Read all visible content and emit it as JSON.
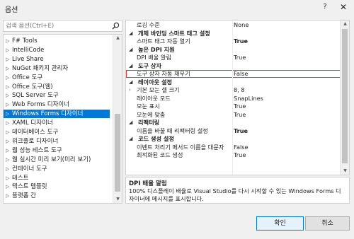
{
  "window": {
    "title": "옵션",
    "help_label": "?",
    "close_label": "✕"
  },
  "search": {
    "placeholder": "검색 옵션(Ctrl+E)"
  },
  "tree": {
    "items": [
      {
        "label": "F# Tools"
      },
      {
        "label": "IntelliCode"
      },
      {
        "label": "Live Share"
      },
      {
        "label": "NuGet 패키지 관리자"
      },
      {
        "label": "Office 도구"
      },
      {
        "label": "Office 도구(웹)"
      },
      {
        "label": "SQL Server 도구"
      },
      {
        "label": "Web Forms 디자이너"
      },
      {
        "label": "Windows Forms 디자이너",
        "selected": true
      },
      {
        "label": "XAML 디자이너"
      },
      {
        "label": "데이터베이스 도구"
      },
      {
        "label": "워크플로 디자이너"
      },
      {
        "label": "웹 성능 테스트 도구"
      },
      {
        "label": "웹 실시간 미리 보기(미리 보기)"
      },
      {
        "label": "컨테이너 도구"
      },
      {
        "label": "테스트"
      },
      {
        "label": "텍스트 템플릿"
      },
      {
        "label": "플랫폼 간"
      }
    ]
  },
  "grid": {
    "rows": [
      {
        "type": "prop",
        "name": "로깅 수준",
        "value": "None"
      },
      {
        "type": "category",
        "name": "개체 바인딩 스마트 태그 설정"
      },
      {
        "type": "prop",
        "name": "스마트 태그 자동 열기",
        "value": "True",
        "bold": true
      },
      {
        "type": "category",
        "name": "높은 DPI 지원"
      },
      {
        "type": "prop",
        "name": "DPI 배율 알림",
        "value": "True"
      },
      {
        "type": "category",
        "name": "도구 상자"
      },
      {
        "type": "prop",
        "name": "도구 상자 자동 채우기",
        "value": "False",
        "highlight": true
      },
      {
        "type": "category",
        "name": "레이아웃 설정"
      },
      {
        "type": "prop",
        "name": "기본 모눈 셀 크기",
        "value": "8, 8",
        "expandable": true
      },
      {
        "type": "prop",
        "name": "레이아웃 모드",
        "value": "SnapLines"
      },
      {
        "type": "prop",
        "name": "모눈 표시",
        "value": "True"
      },
      {
        "type": "prop",
        "name": "모눈에 맞춤",
        "value": "True"
      },
      {
        "type": "category",
        "name": "리팩터링"
      },
      {
        "type": "prop",
        "name": "이름을 바꿀 때 리팩터링 설정",
        "value": "True",
        "bold": true
      },
      {
        "type": "category",
        "name": "코드 생성 설정"
      },
      {
        "type": "prop",
        "name": "이벤트 처리기 메서드 이름을 대문자",
        "value": "False"
      },
      {
        "type": "prop",
        "name": "최적화된 코드 생성",
        "value": "True"
      }
    ]
  },
  "description": {
    "title": "DPI 배율 알림",
    "text": "100% 디스플레이 배율로 Visual Studio를 다시 시작할 수 있는 Windows Forms 디자이너에 메시지를 표시합니다."
  },
  "buttons": {
    "ok": "확인",
    "cancel": "취소"
  }
}
